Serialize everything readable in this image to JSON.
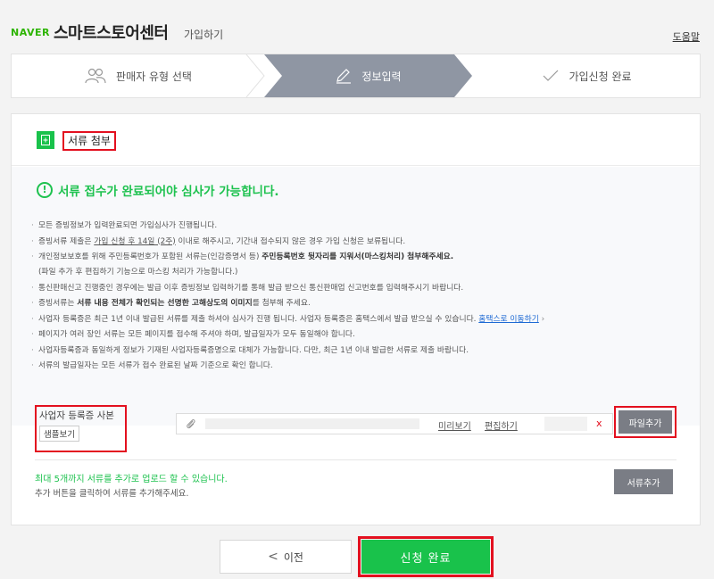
{
  "header": {
    "logo": "NAVER",
    "brand": "스마트스토어센터",
    "subtitle": "가입하기",
    "help_link": "도움말"
  },
  "steps": [
    {
      "label": "판매자 유형 선택",
      "icon": "users-icon"
    },
    {
      "label": "정보입력",
      "icon": "pencil-icon",
      "active": true
    },
    {
      "label": "가입신청 완료",
      "icon": "check-icon"
    }
  ],
  "section": {
    "title": "서류 첨부",
    "icon": "document-plus-icon",
    "notice_title": "서류 접수가 완료되어야 심사가 가능합니다.",
    "notice_icon": "exclamation-circle-icon"
  },
  "notes": {
    "n1": "모든 증빙정보가 입력완료되면 가입심사가 진행됩니다.",
    "n2_a": "증빙서류 제출은 ",
    "n2_u": "가입 신청 후 14일 (2주)",
    "n2_b": " 이내로 해주시고, 기간내 접수되지 않은 경우 가입 신청은 보류됩니다.",
    "n3_a": "개인정보보호를 위해 주민등록번호가 포함된 서류는(인감증명서 등) ",
    "n3_b": "주민등록번호 뒷자리를 지워서(마스킹처리) 첨부해주세요.",
    "n3_sub": "(파일 추가 후 편집하기 기능으로 마스킹 처리가 가능합니다.)",
    "n4": "통신판매신고 진행중인 경우에는 발급 이후 증빙정보 입력하기를 통해 발급 받으신 통신판매업 신고번호를 입력해주시기 바랍니다.",
    "n5_a": "증빙서류는 ",
    "n5_b": "서류 내용 전체가 확인되는 선명한 고해상도의 이미지",
    "n5_c": "를 첨부해 주세요.",
    "n6_a": "사업자 등록증은 최근 1년 이내 발급된 서류를 제출 하셔야 심사가 진행 됩니다. 사업자 등록증은 홈택스에서 발급 받으실 수 있습니다. ",
    "n6_link": "홈택스로 이동하기",
    "n7": "페이지가 여러 장인 서류는 모든 페이지를 접수해 주셔야 하며, 발급일자가 모두 동일해야 합니다.",
    "n8": "사업자등록증과 동일하게 정보가 기재된 사업자등록증명으로 대체가 가능합니다. 다만, 최근 1년 이내 발급한 서류로 제출 바랍니다.",
    "n9": "서류의 발급일자는 모든 서류가 접수 완료된 날짜 기준으로 확인 합니다."
  },
  "upload": {
    "label": "사업자 등록증 사본",
    "sample_button": "샘플보기",
    "preview_link": "미리보기",
    "edit_link": "편집하기",
    "remove": "x",
    "add_file_button": "파일추가"
  },
  "footer_note": {
    "max_files": "최대 5개까지 서류를 추가로 업로드 할 수 있습니다.",
    "instruction": "추가 버튼을 클릭하여 서류를 추가해주세요.",
    "add_doc_button": "서류추가"
  },
  "actions": {
    "prev": "이전",
    "submit": "신청 완료"
  },
  "colors": {
    "naver_green": "#19c24b",
    "highlight_red": "#e3101f",
    "step_active": "#8f96a3",
    "button_gray": "#7a7d85"
  }
}
